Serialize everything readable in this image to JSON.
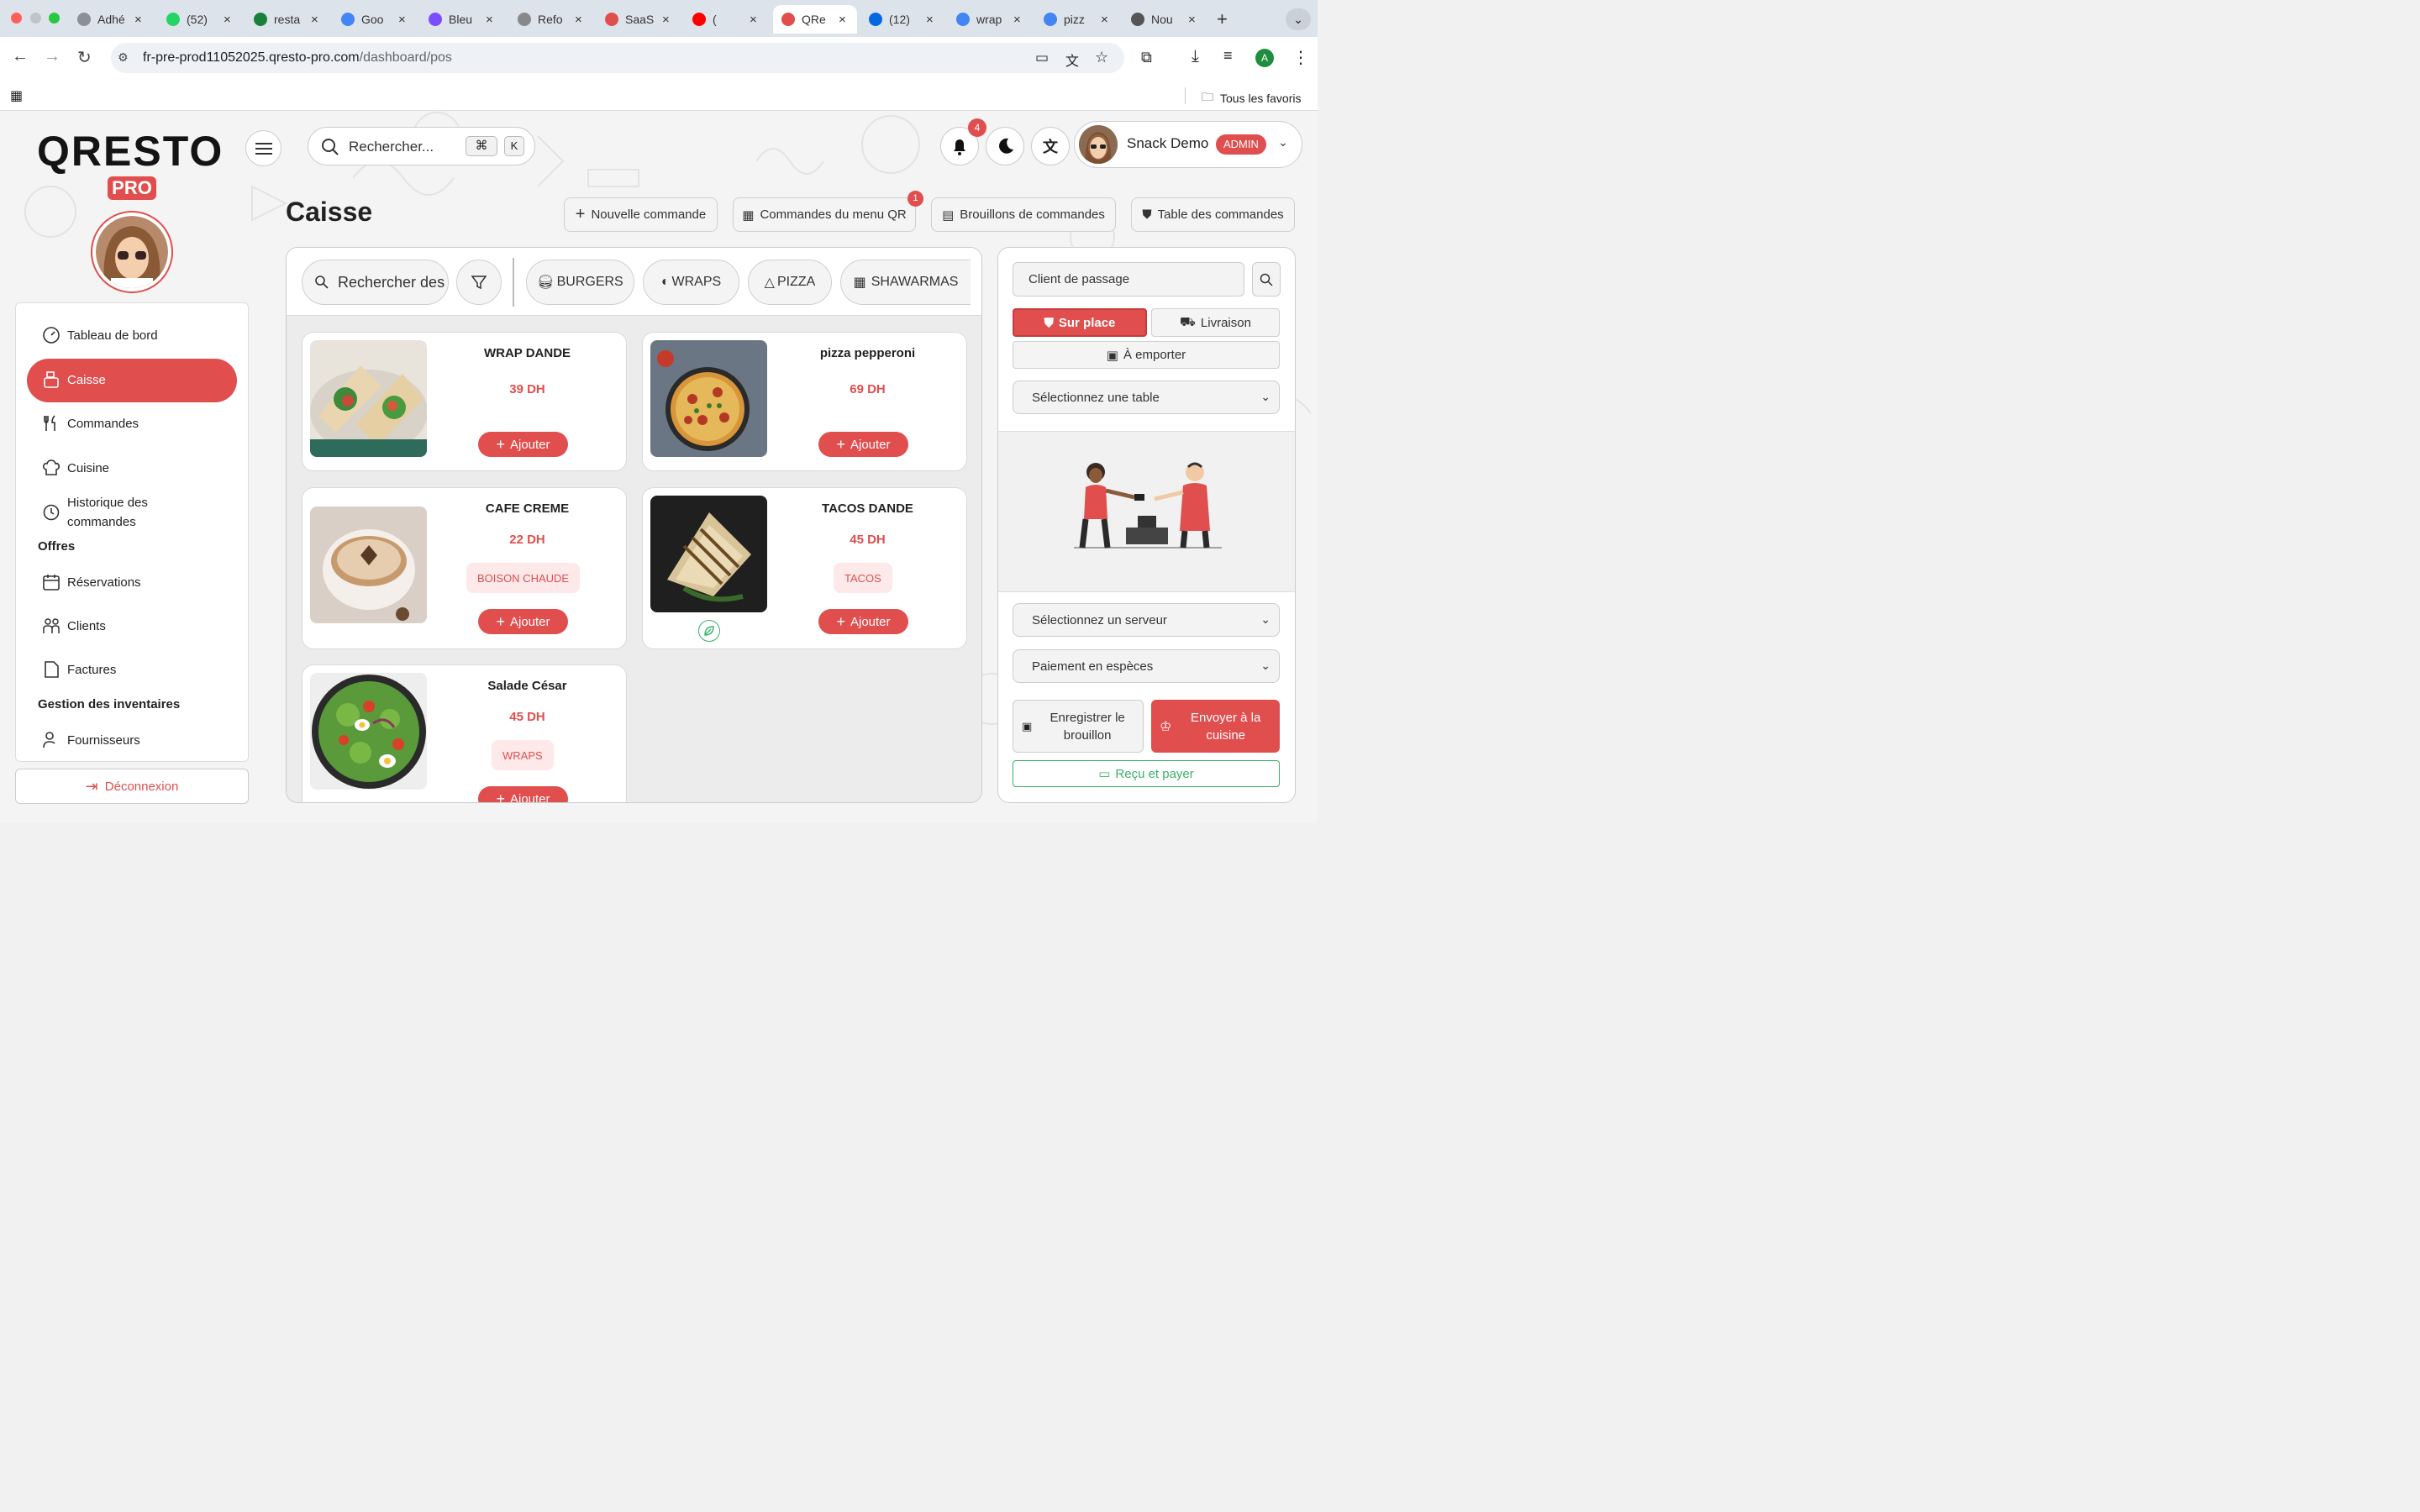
{
  "browser": {
    "tabs": [
      {
        "title": "Adhé",
        "color": "#8a8f98"
      },
      {
        "title": "(52)",
        "color": "#25d366"
      },
      {
        "title": "resta",
        "color": "#188038"
      },
      {
        "title": "Goo",
        "color": "#4285f4"
      },
      {
        "title": "Bleu",
        "color": "#7b4dff"
      },
      {
        "title": "Refo",
        "color": "#888888"
      },
      {
        "title": "SaaS",
        "color": "#e04e4e"
      },
      {
        "title": "(",
        "color": "#ff0000"
      },
      {
        "title": "QRe",
        "color": "#e04e4e"
      },
      {
        "title": "(12)",
        "color": "#0668e1"
      },
      {
        "title": "wrap",
        "color": "#4285f4"
      },
      {
        "title": "pizz",
        "color": "#4285f4"
      },
      {
        "title": "Nou",
        "color": "#555555"
      }
    ],
    "url_domain": "fr-pre-prod11052025.qresto-pro.com",
    "url_path": "/dashboard/pos",
    "bookmarks_label": "Tous les favoris",
    "profile_initial": "A"
  },
  "brand": {
    "logo_text": "QRESTO",
    "logo_badge": "PRO",
    "accent": "#e04e4e"
  },
  "header": {
    "search_placeholder": "Rechercher...",
    "shortcut_cmd": "⌘",
    "shortcut_key": "K",
    "notifications_count": "4",
    "user_name": "Snack Demo",
    "user_role": "ADMIN"
  },
  "sidebar": {
    "items": [
      {
        "label": "Tableau de bord"
      },
      {
        "label": "Caisse"
      },
      {
        "label": "Commandes"
      },
      {
        "label": "Cuisine"
      },
      {
        "label": "Historique des commandes"
      }
    ],
    "section_offres": "Offres",
    "offres_items": [
      {
        "label": "Réservations"
      },
      {
        "label": "Clients"
      },
      {
        "label": "Factures"
      }
    ],
    "section_inventaire": "Gestion des inventaires",
    "inventaire_items": [
      {
        "label": "Fournisseurs"
      }
    ],
    "logout_label": "Déconnexion"
  },
  "page": {
    "title": "Caisse",
    "actions": [
      {
        "label": "Nouvelle commande"
      },
      {
        "label": "Commandes du menu QR",
        "badge": "1"
      },
      {
        "label": "Brouillons de commandes"
      },
      {
        "label": "Table des commandes"
      }
    ]
  },
  "catalog": {
    "search_placeholder": "Rechercher des produits",
    "categories": [
      {
        "label": "BURGERS"
      },
      {
        "label": "WRAPS"
      },
      {
        "label": "PIZZA"
      },
      {
        "label": "SHAWARMAS"
      }
    ],
    "add_label": "Ajouter",
    "products": [
      {
        "name": "WRAP DANDE",
        "price": "39 DH",
        "category": ""
      },
      {
        "name": "pizza pepperoni",
        "price": "69 DH",
        "category": ""
      },
      {
        "name": "CAFE CREME",
        "price": "22 DH",
        "category": "BOISON CHAUDE"
      },
      {
        "name": "TACOS DANDE",
        "price": "45 DH",
        "category": "TACOS"
      },
      {
        "name": "Salade César",
        "price": "45 DH",
        "category": "WRAPS"
      }
    ]
  },
  "order": {
    "client_value": "Client de passage",
    "modes": [
      {
        "label": "Sur place",
        "active": true
      },
      {
        "label": "Livraison",
        "active": false
      },
      {
        "label": "À emporter",
        "active": false
      }
    ],
    "table_select": "Sélectionnez une table",
    "server_select": "Sélectionnez un serveur",
    "payment_select": "Paiement en espèces",
    "draft_button": "Enregistrer le brouillon",
    "kitchen_button": "Envoyer à la cuisine",
    "receipt_button": "Reçu et payer"
  }
}
